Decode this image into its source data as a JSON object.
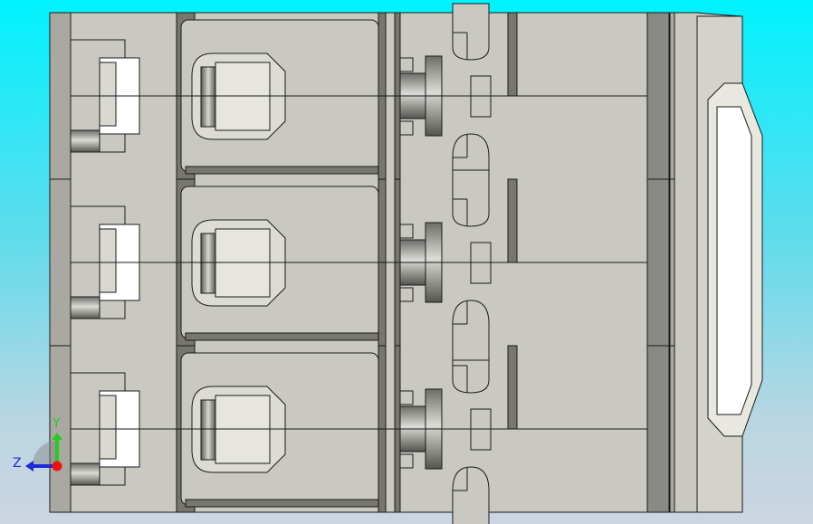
{
  "viewport": {
    "colors": {
      "body": "#c9c9c1",
      "dark": "#77776f",
      "outline": "#1a1a1a"
    }
  },
  "triad": {
    "y_label": "Y",
    "z_label": "Z",
    "y_color": "#22cc22",
    "z_color": "#1c2bd6",
    "origin_color": "#ee1111"
  }
}
